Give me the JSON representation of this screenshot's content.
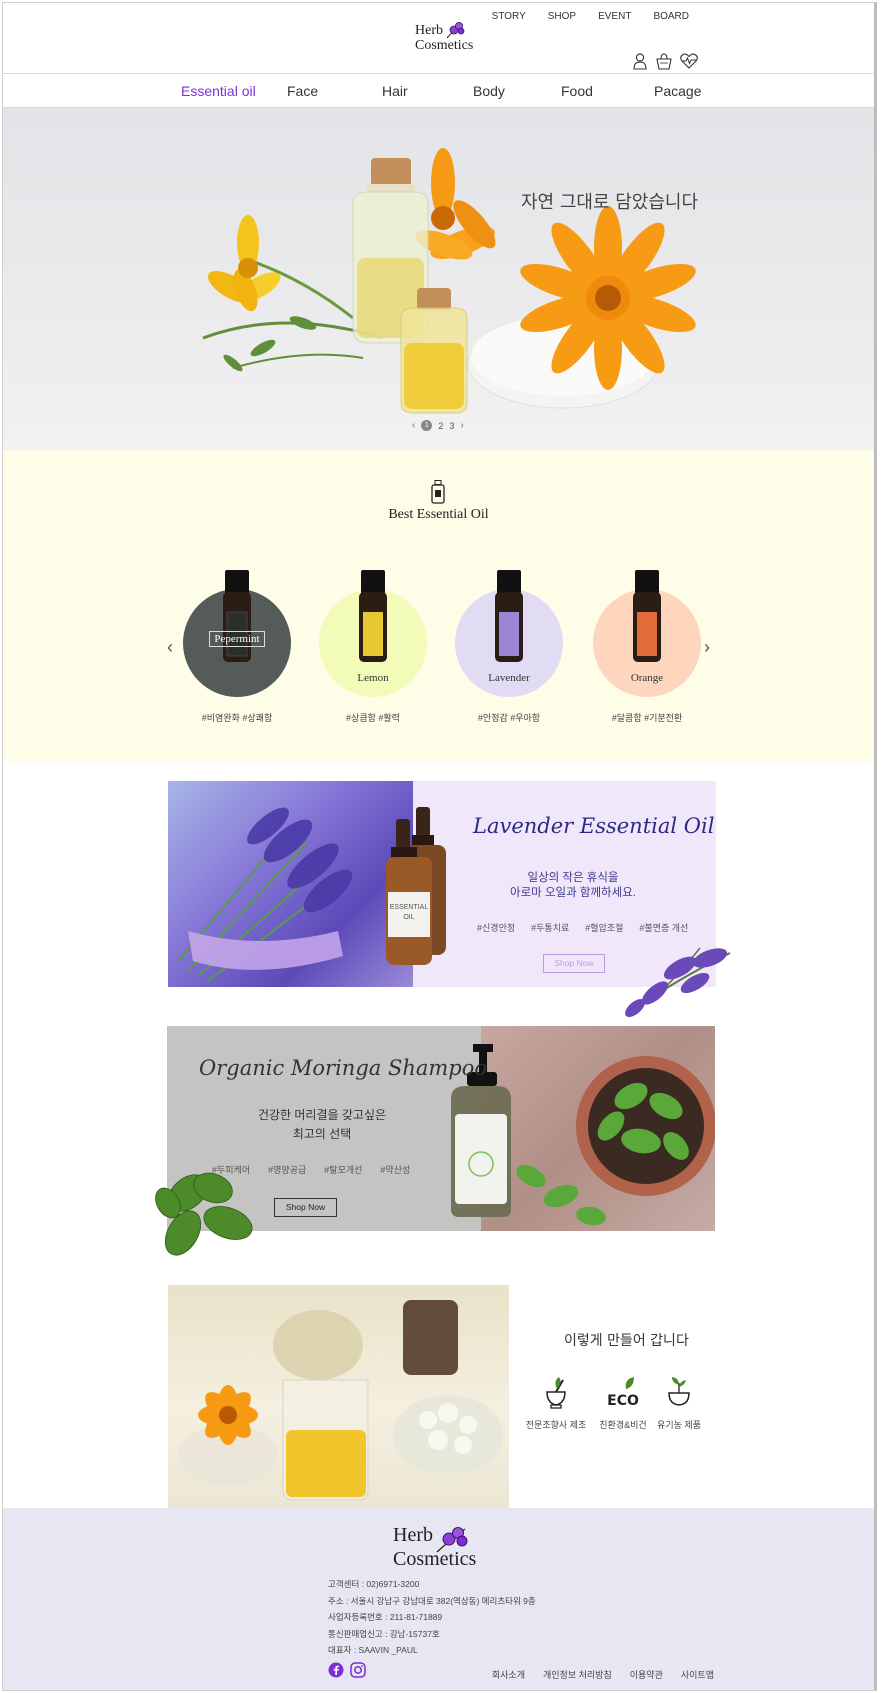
{
  "brand": {
    "line1": "Herb",
    "line2": "Cosmetics"
  },
  "topnav": [
    "STORY",
    "SHOP",
    "EVENT",
    "BOARD"
  ],
  "mainnav": [
    "Essential oil",
    "Face",
    "Hair",
    "Body",
    "Food",
    "Pacage"
  ],
  "hero": {
    "title": "자연 그대로 담았습니다",
    "pager": [
      "1",
      "2",
      "3"
    ]
  },
  "best": {
    "title": "Best Essential Oil",
    "items": [
      {
        "name": "Pepermint",
        "tags": "#비염완화  #상쾌함",
        "color": "#555b59",
        "label_color": "#2a2f2a"
      },
      {
        "name": "Lemon",
        "tags": "#상큼함  #활력",
        "color": "#f2fbb8",
        "label_color": "#e8c832"
      },
      {
        "name": "Lavender",
        "tags": "#안정감  #우아함",
        "color": "#e1dbf4",
        "label_color": "#9a85d6"
      },
      {
        "name": "Orange",
        "tags": "#달콤함  #기분전환",
        "color": "#fdd6bd",
        "label_color": "#e26b3c"
      }
    ]
  },
  "lavender": {
    "title": "Lavender Essential Oil",
    "sub1": "일상의 작은 휴식을",
    "sub2": "아로마 오일과 함께하세요.",
    "tags": [
      "#신경안정",
      "#두통치료",
      "#혈압조절",
      "#불면증 개선"
    ],
    "button": "Shop Now",
    "bottle_label": "ESSENTIAL OIL"
  },
  "moringa": {
    "title": "Organic Moringa Shampoo",
    "sub1": "건강한 머리결을 갖고싶은",
    "sub2": "최고의 선택",
    "tags": [
      "#두피케어",
      "#영양공급",
      "#탈모개선",
      "#약산성"
    ],
    "button": "Shop Now"
  },
  "process": {
    "title": "이렇게 만들어 갑니다",
    "items": [
      "전문조향사 제조",
      "친환경&비건",
      "유기농 제품"
    ]
  },
  "footer": {
    "brand1": "Herb",
    "brand2": "Cosmetics",
    "info": [
      "고객센터 : 02)6971-3200",
      "주소 : 서울시 강남구 강남대로 382(역삼동) 메리츠타워 9층",
      "사업자등록번호 : 211-81-71889",
      "통신판매업신고 : 강남-15737호",
      "대표자 : SAAVIN _PAUL"
    ],
    "links": [
      "회사소개",
      "개인정보 처리방침",
      "이용약관",
      "사이트맵"
    ]
  },
  "colors": {
    "accent": "#7a2fd6",
    "best_bg": "#fefde8",
    "footer_bg": "#e7e7f4"
  }
}
